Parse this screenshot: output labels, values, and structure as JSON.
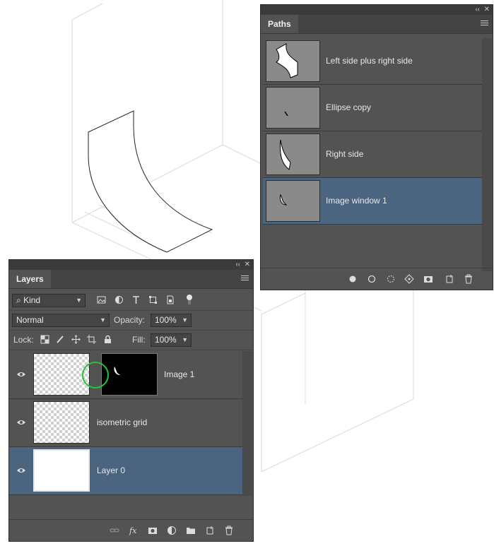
{
  "paths_panel": {
    "tab": "Paths",
    "collapse_glyph": "‹‹",
    "close_glyph": "✕",
    "paths": [
      {
        "name": "Left side plus right side",
        "selected": false
      },
      {
        "name": "Ellipse copy",
        "selected": false
      },
      {
        "name": "Right side",
        "selected": false
      },
      {
        "name": "Image window 1",
        "selected": true
      }
    ],
    "footer_icons": [
      "fill-path-icon",
      "stroke-path-icon",
      "load-selection-icon",
      "make-work-path-icon",
      "add-mask-icon",
      "new-path-icon",
      "delete-icon"
    ]
  },
  "layers_panel": {
    "tab": "Layers",
    "collapse_glyph": "‹‹",
    "close_glyph": "✕",
    "filter_kind": "Kind",
    "blend_mode": "Normal",
    "opacity_label": "Opacity:",
    "opacity_value": "100%",
    "lock_label": "Lock:",
    "fill_label": "Fill:",
    "fill_value": "100%",
    "layers": [
      {
        "name": "Image 1",
        "visible": true,
        "selected": false,
        "has_mask": true
      },
      {
        "name": "isometric grid",
        "visible": true,
        "selected": false,
        "has_mask": false
      },
      {
        "name": "Layer 0",
        "visible": true,
        "selected": true,
        "has_mask": false
      }
    ],
    "footer_icons": [
      "link-icon",
      "fx-icon",
      "add-mask-icon",
      "adjustment-icon",
      "group-icon",
      "new-layer-icon",
      "delete-icon"
    ]
  },
  "colors": {
    "panel_bg": "#535353",
    "selected_row": "#4b6480",
    "highlight_circle": "#22c43a"
  }
}
